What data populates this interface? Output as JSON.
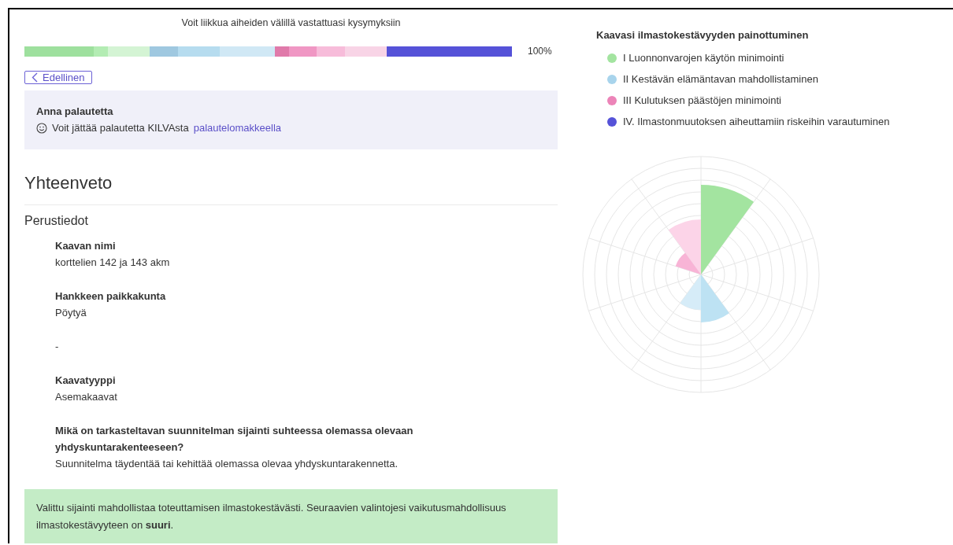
{
  "progress": {
    "caption": "Voit liikkua aiheiden välillä vastattuasi kysymyksiin",
    "reading": "100%",
    "segments": [
      {
        "color": "#9ee09e"
      },
      {
        "color": "#b3ecb3"
      },
      {
        "color": "#d4f4d4"
      },
      {
        "color": "#9fc8e0"
      },
      {
        "color": "#b6dcef"
      },
      {
        "color": "#d0e8f5"
      },
      {
        "color": "#e07aaa"
      },
      {
        "color": "#f097c4"
      },
      {
        "color": "#f7bcda"
      },
      {
        "color": "#f8d4e6"
      },
      {
        "color": "#5552d8"
      }
    ]
  },
  "back_button": {
    "label": "Edellinen"
  },
  "feedback": {
    "title": "Anna palautetta",
    "text": "Voit jättää palautetta KILVAsta",
    "link": "palautelomakkeella"
  },
  "summary": {
    "title": "Yhteenveto",
    "section": "Perustiedot",
    "fields": [
      {
        "label": "Kaavan nimi",
        "value": "korttelien 142 ja 143 akm"
      },
      {
        "label": "Hankkeen paikkakunta",
        "value": "Pöytyä"
      },
      {
        "value": "-"
      },
      {
        "label": "Kaavatyyppi",
        "value": "Asemakaavat"
      },
      {
        "label": "Mikä on tarkasteltavan suunnitelman sijainti suhteessa olemassa olevaan yhdyskuntarakenteeseen?",
        "value": "Suunnitelma täydentää tai kehittää olemassa olevaa yhdyskuntarakennetta."
      }
    ],
    "note": "Valittu sijainti mahdollistaa toteuttamisen ilmastokestävästi. Seuraavien valintojesi vaikutusmahdollisuus ilmastokestävyyteen on **suuri**."
  },
  "legend": {
    "title": "Kaavasi ilmastokestävyyden painottuminen",
    "items": [
      {
        "label": "I Luonnonvarojen käytön minimointi",
        "color": "#a3e4a0"
      },
      {
        "label": "II Kestävän elämäntavan mahdollistaminen",
        "color": "#a8d4ec"
      },
      {
        "label": "III Kulutuksen päästöjen minimointi",
        "color": "#ec84b8"
      },
      {
        "label": "IV. Ilmastonmuutoksen aiheuttamiin riskeihin varautuminen",
        "color": "#5552d8"
      }
    ]
  }
}
